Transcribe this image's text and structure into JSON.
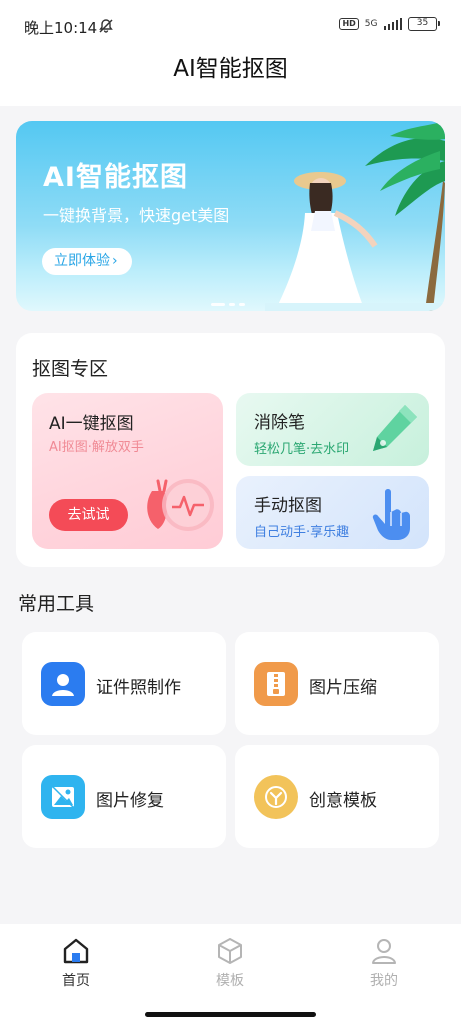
{
  "status_bar": {
    "time": "晚上10:14",
    "hd_badge": "HD",
    "network": "5G",
    "battery": "35"
  },
  "header": {
    "title": "AI智能抠图"
  },
  "banner": {
    "title": "AI智能抠图",
    "subtitle": "一键换背景，快速get美图",
    "cta_label": "立即体验"
  },
  "cutout_section": {
    "title": "抠图专区",
    "ai_card": {
      "title": "AI一键抠图",
      "subtitle": "AI抠图·解放双手",
      "button_label": "去试试"
    },
    "eraser_card": {
      "title": "消除笔",
      "subtitle": "轻松几笔·去水印"
    },
    "manual_card": {
      "title": "手动抠图",
      "subtitle": "自己动手·享乐趣"
    }
  },
  "tools_section": {
    "title": "常用工具",
    "items": [
      {
        "label": "证件照制作",
        "icon": "id-photo-icon",
        "color": "#2b7cf0"
      },
      {
        "label": "图片压缩",
        "icon": "zip-icon",
        "color": "#f09a4a"
      },
      {
        "label": "图片修复",
        "icon": "image-repair-icon",
        "color": "#2fb4ef"
      },
      {
        "label": "创意模板",
        "icon": "creative-template-icon",
        "color": "#f2c35a"
      }
    ]
  },
  "tab_bar": {
    "items": [
      {
        "label": "首页",
        "icon": "home-icon",
        "active": true
      },
      {
        "label": "模板",
        "icon": "cube-icon",
        "active": false
      },
      {
        "label": "我的",
        "icon": "profile-icon",
        "active": false
      }
    ],
    "active_color": "#333333",
    "inactive_color": "#b0b0b0"
  }
}
